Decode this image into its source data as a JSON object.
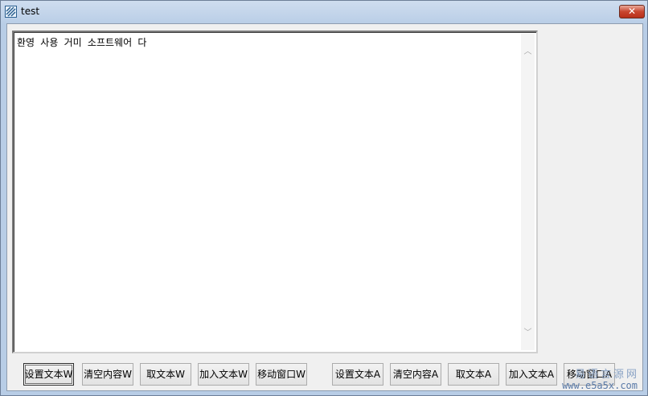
{
  "window": {
    "title": "test",
    "close_glyph": "✕"
  },
  "edit": {
    "text": "환영 사용 거미 소프트웨어 다"
  },
  "buttons": [
    {
      "label": "设置文本W"
    },
    {
      "label": "清空内容W"
    },
    {
      "label": "取文本W"
    },
    {
      "label": "加入文本W"
    },
    {
      "label": "移动窗口W"
    },
    {
      "label": "设置文本A"
    },
    {
      "label": "清空内容A"
    },
    {
      "label": "取文本A"
    },
    {
      "label": "加入文本A"
    },
    {
      "label": "移动窗口A"
    }
  ],
  "watermark": {
    "top": "易语言源网",
    "bottom": "www.e5a5x.com"
  }
}
